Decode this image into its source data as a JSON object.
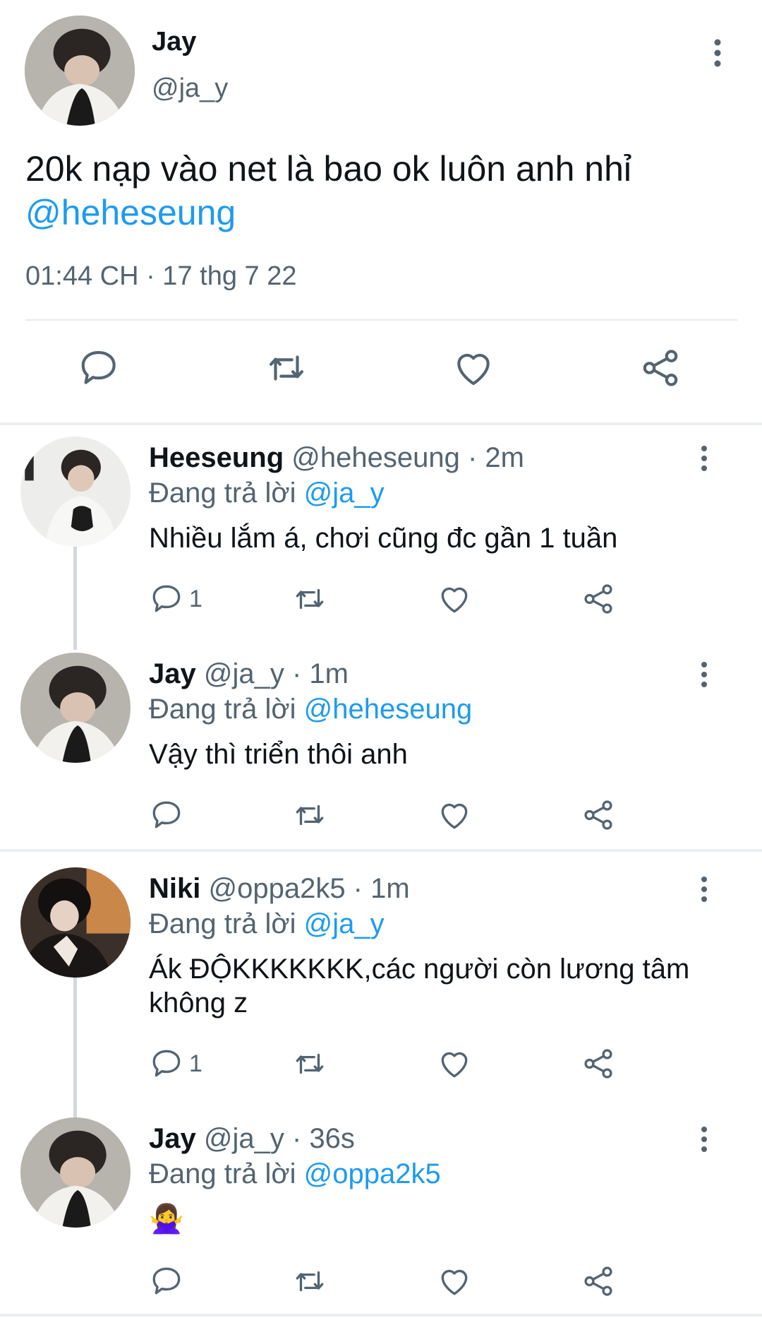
{
  "main_tweet": {
    "author_name": "Jay",
    "author_handle": "@ja_y",
    "text": "20k nạp vào net là bao ok luôn anh nhỉ",
    "mention": "@heheseung",
    "timestamp": "01:44 CH · 17 thg 7 22",
    "actions": [
      "reply-icon",
      "retweet-icon",
      "like-icon",
      "share-icon"
    ]
  },
  "replies": [
    {
      "name": "Heeseung",
      "meta": "@heheseung · 2m",
      "replying_label": "Đang trả lời",
      "replying_to": "@ja_y",
      "body": "Nhiều lắm á, chơi cũng đc gần 1 tuần",
      "reply_count": "1"
    },
    {
      "name": "Jay",
      "meta": "@ja_y · 1m",
      "replying_label": "Đang trả lời",
      "replying_to": "@heheseung",
      "body": "Vậy thì triển thôi anh",
      "reply_count": ""
    },
    {
      "name": "Niki",
      "meta": "@oppa2k5 · 1m",
      "replying_label": "Đang trả lời",
      "replying_to": "@ja_y",
      "body": "Ák ĐỘKKKKKKK,các người còn lương tâm không z",
      "reply_count": "1"
    },
    {
      "name": "Jay",
      "meta": "@ja_y · 36s",
      "replying_label": "Đang trả lời",
      "replying_to": "@oppa2k5",
      "body": "🙅‍♀️",
      "reply_count": ""
    }
  ],
  "colors": {
    "accent": "#1d9bf0",
    "secondary_text": "#536471",
    "icon": "#536471"
  }
}
